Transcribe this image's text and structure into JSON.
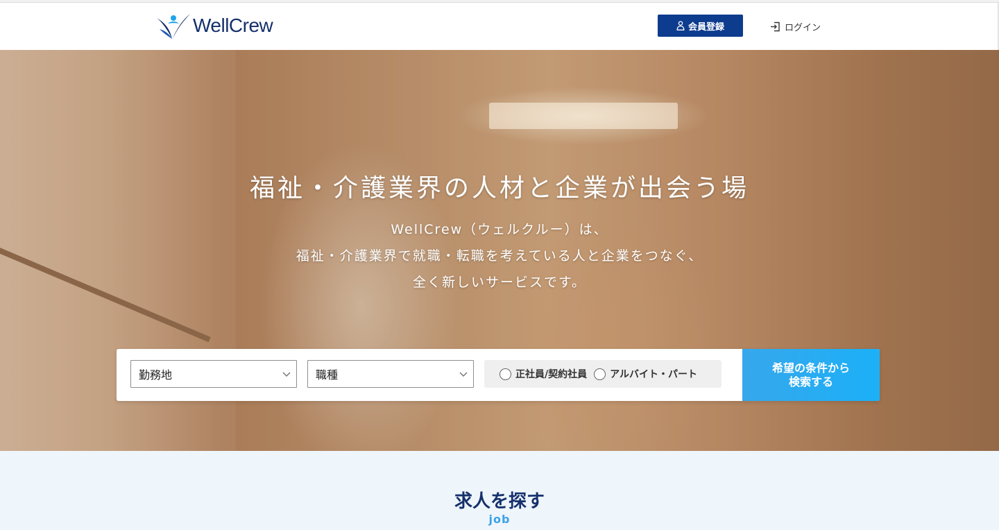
{
  "header": {
    "logo_text": "WellCrew",
    "register_label": "会員登録",
    "login_label": "ログイン"
  },
  "hero": {
    "title": "福祉・介護業界の人材と企業が出会う場",
    "description_lines": [
      "WellCrew（ウェルクルー）は、",
      "福祉・介護業界で就職・転職を考えている人と企業をつなぐ、",
      "全く新しいサービスです。"
    ]
  },
  "search": {
    "area_select": "勤務地",
    "job_select": "職種",
    "employment_options": [
      "正社員/契約社員",
      "アルバイト・パート"
    ],
    "button_lines": [
      "希望の条件から",
      "検索する"
    ]
  },
  "section": {
    "title": "求人を探す",
    "subtitle": "job"
  },
  "colors": {
    "brand_navy": "#0d3b8e",
    "search_button": "#1bb0f7",
    "section_bg": "#eef5fb",
    "accent_blue": "#3aa2e6"
  },
  "icons": {
    "register": "person-icon",
    "login": "login-icon",
    "select": "chevron-down-icon"
  }
}
